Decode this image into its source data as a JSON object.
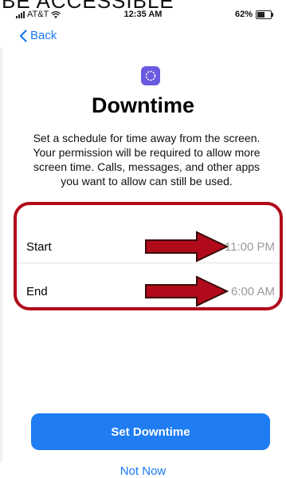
{
  "clipped_heading": "BE ACCESSIBLE",
  "status": {
    "carrier": "AT&T",
    "time": "12:35 AM",
    "battery": "62%",
    "battery_level": 0.62
  },
  "nav": {
    "back_label": "Back"
  },
  "screen": {
    "title": "Downtime",
    "description": "Set a schedule for time away from the screen. Your permission will be required to allow more screen time. Calls, messages, and other apps you want to allow can still be used."
  },
  "schedule": {
    "start_label": "Start",
    "start_value": "11:00 PM",
    "end_label": "End",
    "end_value": "6:00 AM"
  },
  "buttons": {
    "primary_label": "Set Downtime",
    "secondary_label": "Not Now"
  },
  "colors": {
    "accent": "#1f7cf2",
    "highlight": "#b10a1a",
    "app_icon": "#6a5ae0"
  }
}
